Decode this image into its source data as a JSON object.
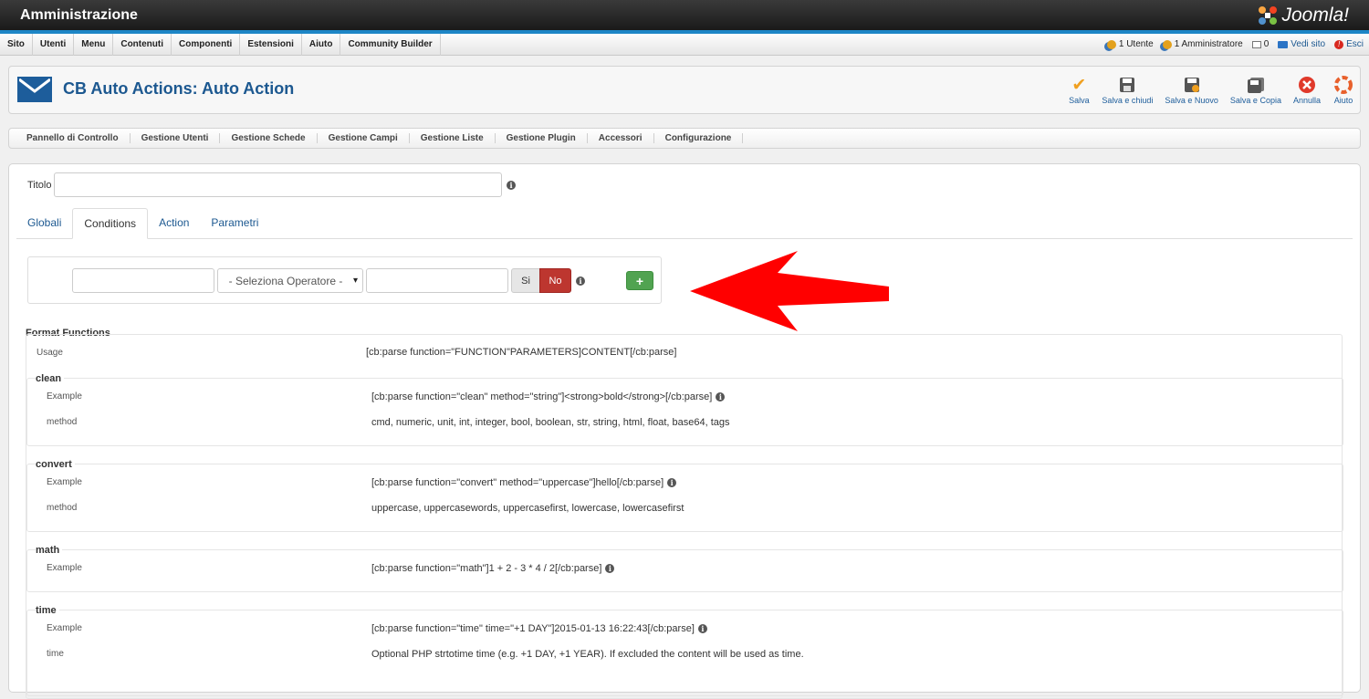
{
  "header": {
    "title": "Amministrazione",
    "logo_text": "Joomla!"
  },
  "menu": {
    "items": [
      "Sito",
      "Utenti",
      "Menu",
      "Contenuti",
      "Componenti",
      "Estensioni",
      "Aiuto",
      "Community Builder"
    ],
    "status": {
      "users": "1 Utente",
      "admins": "1 Amministratore",
      "messages": "0",
      "view_site": "Vedi sito",
      "logout": "Esci"
    }
  },
  "page": {
    "title": "CB Auto Actions: Auto Action"
  },
  "toolbar": {
    "save": "Salva",
    "save_close": "Salva e chiudi",
    "save_new": "Salva e Nuovo",
    "save_copy": "Salva e Copia",
    "cancel": "Annulla",
    "help": "Aiuto"
  },
  "subnav": [
    "Pannello di Controllo",
    "Gestione Utenti",
    "Gestione Schede",
    "Gestione Campi",
    "Gestione Liste",
    "Gestione Plugin",
    "Accessori",
    "Configurazione"
  ],
  "form": {
    "title_label": "Titolo",
    "title_value": "",
    "tabs": [
      "Globali",
      "Conditions",
      "Action",
      "Parametri"
    ],
    "active_tab": "Conditions",
    "condition": {
      "field1": "",
      "operator": "- Seleziona Operatore -",
      "field2": "",
      "yes": "Si",
      "no": "No",
      "add": "+"
    }
  },
  "format_functions": {
    "title": "Format Functions",
    "usage_label": "Usage",
    "usage_value": "[cb:parse function=\"FUNCTION\"PARAMETERS]CONTENT[/cb:parse]",
    "clean": {
      "name": "clean",
      "example_label": "Example",
      "example": "[cb:parse function=\"clean\" method=\"string\"]<strong>bold</strong>[/cb:parse]",
      "method_label": "method",
      "method": "cmd, numeric, unit, int, integer, bool, boolean, str, string, html, float, base64, tags"
    },
    "convert": {
      "name": "convert",
      "example_label": "Example",
      "example": "[cb:parse function=\"convert\" method=\"uppercase\"]hello[/cb:parse]",
      "method_label": "method",
      "method": "uppercase, uppercasewords, uppercasefirst, lowercase, lowercasefirst"
    },
    "math": {
      "name": "math",
      "example_label": "Example",
      "example": "[cb:parse function=\"math\"]1 + 2 - 3 * 4 / 2[/cb:parse]"
    },
    "time": {
      "name": "time",
      "example_label": "Example",
      "example": "[cb:parse function=\"time\" time=\"+1 DAY\"]2015-01-13 16:22:43[/cb:parse]",
      "time_label": "time",
      "time": "Optional PHP strtotime time (e.g. +1 DAY, +1 YEAR). If excluded the content will be used as time."
    }
  },
  "colors": {
    "accent": "#1c5890",
    "header_bar": "#1d86c6",
    "no_button": "#bd362f",
    "add_button": "#51a351",
    "arrow": "#ff0000"
  }
}
